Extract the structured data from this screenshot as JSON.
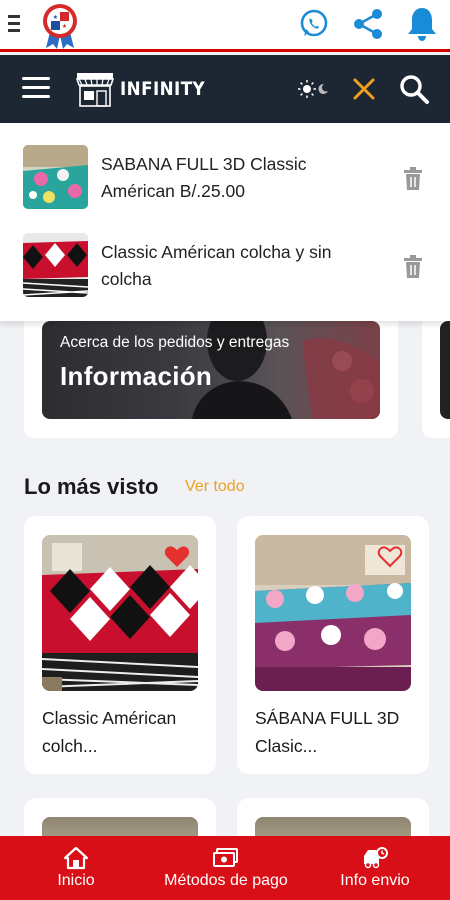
{
  "topbar": {
    "menu_icon": "vertical-menu-icon",
    "flag_icon": "panama-flag-badge-icon",
    "actions": [
      "whatsapp-icon",
      "share-icon",
      "bell-icon"
    ]
  },
  "navbar": {
    "brand": "INFINITY",
    "theme_icon": "sun-moon-icon",
    "close_icon": "close-icon",
    "search_icon": "search-icon"
  },
  "search_results": [
    {
      "text": "SABANA FULL 3D Classic Américan B/.25.00",
      "thumb_icon": "bedsheet-teal-floral"
    },
    {
      "text": "Classic Américan colcha y sin colcha",
      "thumb_icon": "bedsheet-red-black"
    }
  ],
  "info_banner": {
    "subtitle": "Acerca de los pedidos y entregas",
    "title": "Información"
  },
  "most_viewed": {
    "title": "Lo más visto",
    "link": "Ver todo",
    "products": [
      {
        "title": "Classic Américan colch...",
        "favorited": true
      },
      {
        "title": "SÁBANA FULL 3D Clasic...",
        "favorited": false
      }
    ]
  },
  "bottom_nav": [
    {
      "label": "Inicio",
      "icon": "home-icon"
    },
    {
      "label": "Métodos de pago",
      "icon": "money-icon"
    },
    {
      "label": "Info envio",
      "icon": "delivery-truck-icon"
    }
  ],
  "colors": {
    "accent_red": "#d80f16",
    "nav_dark": "#1d2733",
    "link_orange": "#f0a020",
    "icon_blue": "#1a8bd6"
  }
}
